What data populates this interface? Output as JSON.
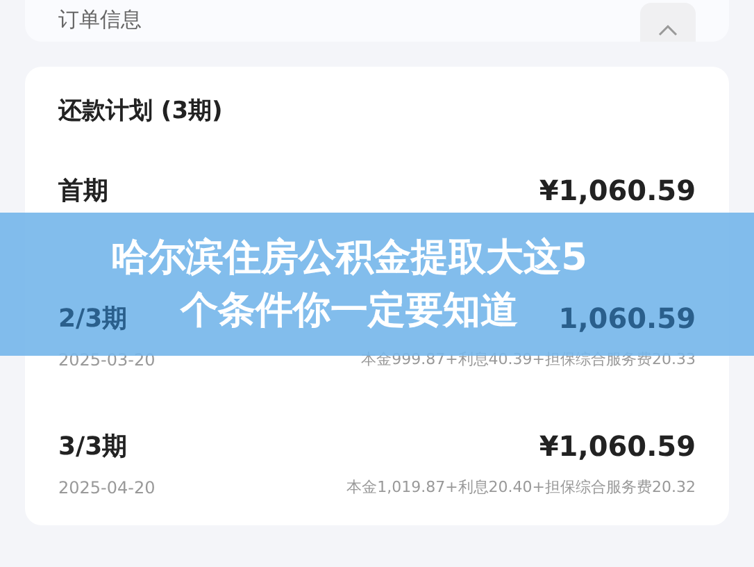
{
  "order_card": {
    "title": "订单信息",
    "expanded": true
  },
  "plan": {
    "title": "还款计划 (3期)",
    "rows": [
      {
        "period": "首期",
        "amount": "¥1,060.59"
      },
      {
        "period": "2/3期",
        "amount": "1,060.59",
        "date": "2025-03-20",
        "detail": "本金999.87+利息40.39+担保综合服务费20.33"
      },
      {
        "period": "3/3期",
        "amount": "¥1,060.59",
        "date": "2025-04-20",
        "detail": "本金1,019.87+利息20.40+担保综合服务费20.32"
      }
    ]
  },
  "banner": {
    "lines": [
      "哈尔滨住房公积金提取大这5",
      "个条件你一定要知道"
    ]
  }
}
